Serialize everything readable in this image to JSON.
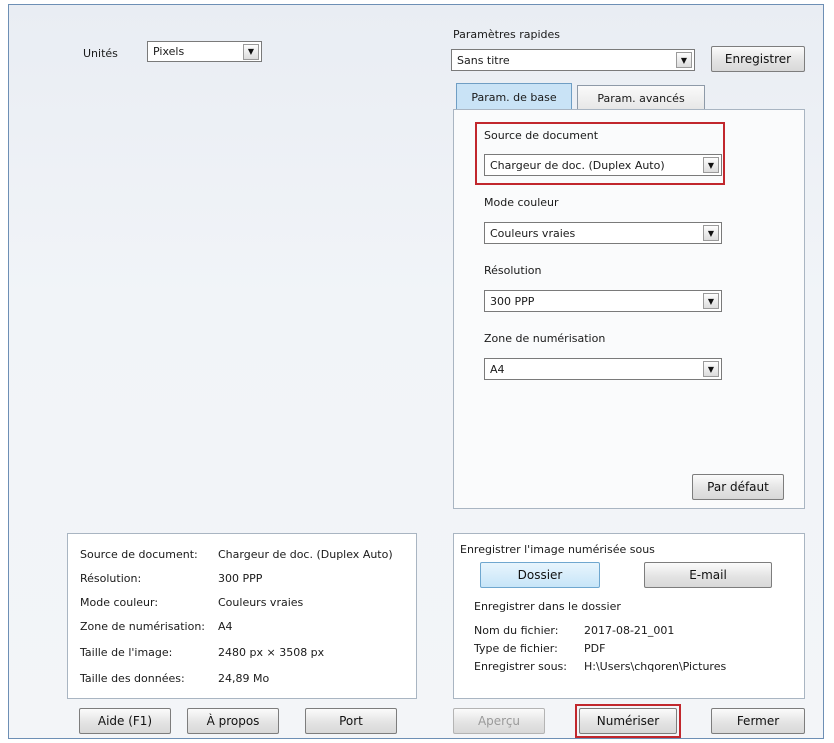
{
  "units": {
    "label": "Unités",
    "value": "Pixels"
  },
  "quick_settings": {
    "label": "Paramètres rapides",
    "value": "Sans titre",
    "save_button": "Enregistrer"
  },
  "tabs": [
    {
      "label": "Param. de base",
      "active": true
    },
    {
      "label": "Param. avancés",
      "active": false
    }
  ],
  "basic": {
    "source": {
      "label": "Source de document",
      "value": "Chargeur de doc. (Duplex Auto)"
    },
    "color_mode": {
      "label": "Mode couleur",
      "value": "Couleurs vraies"
    },
    "resolution": {
      "label": "Résolution",
      "value": "300 PPP"
    },
    "scan_area": {
      "label": "Zone de numérisation",
      "value": "A4"
    },
    "default_button": "Par défaut"
  },
  "summary": {
    "rows": [
      {
        "label": "Source de document:",
        "value": "Chargeur de doc. (Duplex Auto)"
      },
      {
        "label": "Résolution:",
        "value": "300 PPP"
      },
      {
        "label": "Mode couleur:",
        "value": "Couleurs vraies"
      },
      {
        "label": "Zone de numérisation:",
        "value": "A4"
      },
      {
        "label": "Taille de l'image:",
        "value": "2480 px × 3508 px"
      },
      {
        "label": "Taille des données:",
        "value": "24,89 Mo"
      }
    ]
  },
  "save_as": {
    "title": "Enregistrer l'image numérisée sous",
    "folder_button": "Dossier",
    "email_button": "E-mail",
    "subtitle": "Enregistrer dans le dossier",
    "rows": [
      {
        "label": "Nom du fichier:",
        "value": "2017-08-21_001"
      },
      {
        "label": "Type de fichier:",
        "value": "PDF"
      },
      {
        "label": "Enregistrer sous:",
        "value": "H:\\Users\\chqoren\\Pictures"
      }
    ]
  },
  "footer": {
    "help": "Aide (F1)",
    "about": "À propos",
    "port": "Port",
    "preview": "Aperçu",
    "scan": "Numériser",
    "close": "Fermer"
  },
  "colors": {
    "highlight": "#c1272d",
    "tab_active": "#c9e3f6",
    "button_blue": "#c7e5f8"
  }
}
